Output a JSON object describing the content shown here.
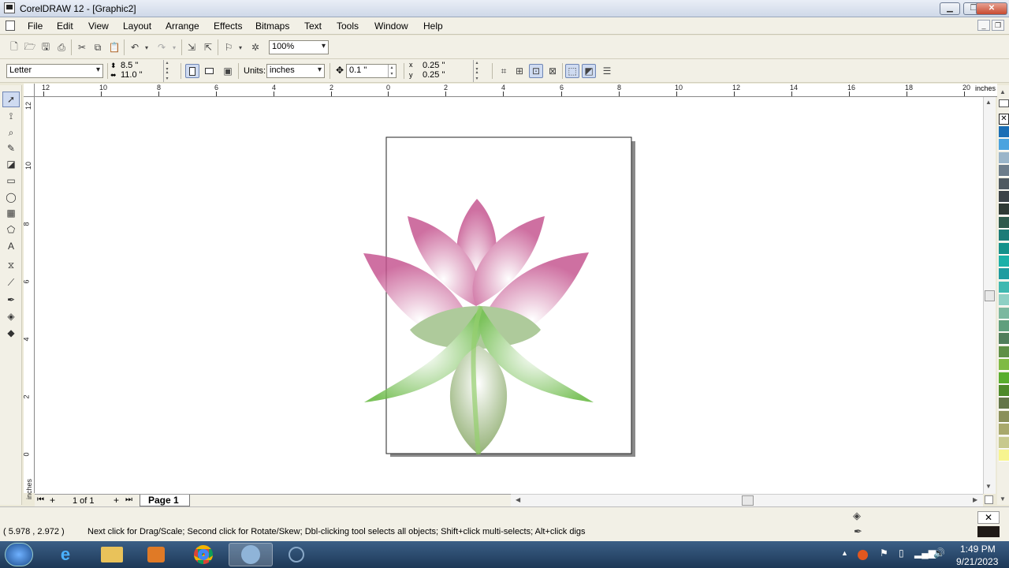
{
  "window": {
    "title": "CorelDRAW 12 - [Graphic2]",
    "min": "▁",
    "max": "❐",
    "close": "✕"
  },
  "menu": [
    "File",
    "Edit",
    "View",
    "Layout",
    "Arrange",
    "Effects",
    "Bitmaps",
    "Text",
    "Tools",
    "Window",
    "Help"
  ],
  "mdi": {
    "min": "_",
    "restore": "❐",
    "close": "✕"
  },
  "standard_toolbar": {
    "zoom": "100%"
  },
  "property_bar": {
    "paper": "Letter",
    "width": "8.5 \"",
    "height": "11.0 \"",
    "units_label": "Units:",
    "units": "inches",
    "nudge": "0.1 \"",
    "dup_x": "0.25 \"",
    "dup_y": "0.25 \""
  },
  "rulers": {
    "h_labels": [
      "12",
      "10",
      "8",
      "6",
      "4",
      "2",
      "0",
      "2",
      "4",
      "6",
      "8",
      "10",
      "12",
      "14",
      "16",
      "18",
      "20"
    ],
    "unit": "inches",
    "v_labels": [
      "12",
      "10",
      "8",
      "6",
      "4",
      "2",
      "0"
    ]
  },
  "pages": {
    "count": "1 of 1",
    "tab": "Page 1"
  },
  "status": {
    "coords": "( 5.978 , 2.972 )",
    "message": "Next click for Drag/Scale; Second click for Rotate/Skew; Dbl-clicking tool selects all objects; Shift+click multi-selects; Alt+click digs"
  },
  "palette": [
    "#ffffff",
    "#1b6fb5",
    "#4aa3df",
    "#9ab5c9",
    "#6d7d8b",
    "#4f5a62",
    "#3b4247",
    "#2f3a35",
    "#2e5a4c",
    "#1c7c78",
    "#15928b",
    "#1bb1a8",
    "#1e9ca0",
    "#3fb8b0",
    "#8ed0c4",
    "#7bb89f",
    "#5f9f7d",
    "#507e5c",
    "#5e8f46",
    "#7fba44",
    "#59ad2e",
    "#4e8a2a",
    "#637649",
    "#8a8f5a",
    "#a8a86c",
    "#c7c98e",
    "#f7f48f"
  ],
  "tray": {
    "time": "1:49 PM",
    "date": "9/21/2023"
  }
}
